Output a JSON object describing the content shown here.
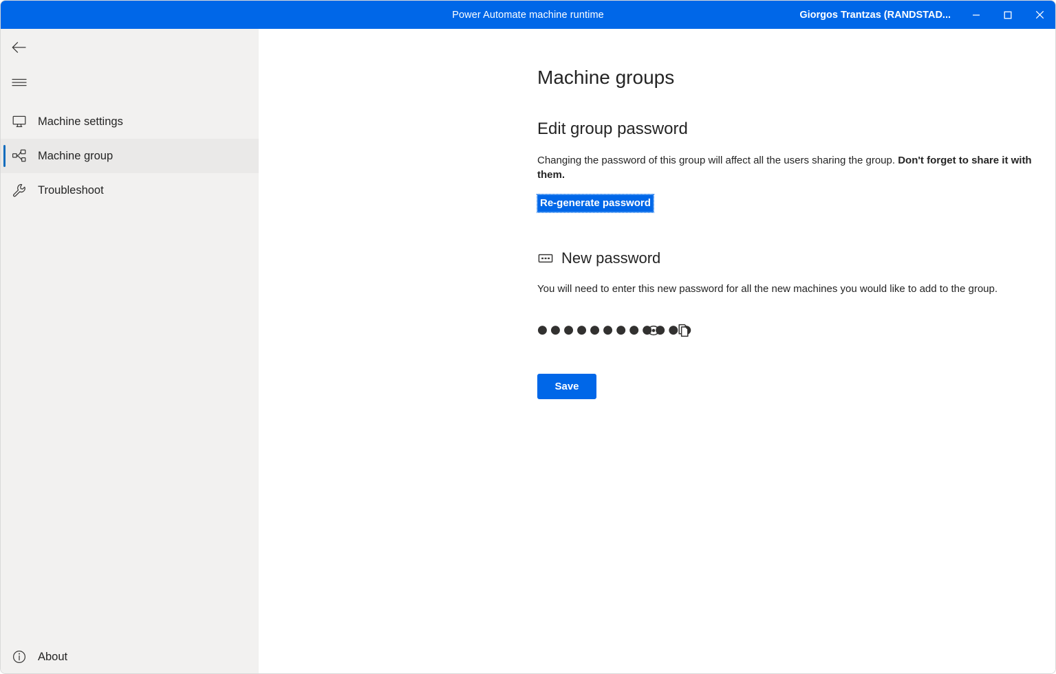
{
  "titlebar": {
    "title": "Power Automate machine runtime",
    "account": "Giorgos Trantzas (RANDSTAD...",
    "minimize_label": "Minimize",
    "maximize_label": "Maximize",
    "close_label": "Close"
  },
  "sidebar": {
    "back_label": "Back",
    "menu_label": "Menu",
    "items": [
      {
        "label": "Machine settings",
        "icon": "monitor-icon",
        "selected": false
      },
      {
        "label": "Machine group",
        "icon": "machine-group-icon",
        "selected": true
      },
      {
        "label": "Troubleshoot",
        "icon": "wrench-icon",
        "selected": false
      }
    ],
    "about": {
      "label": "About",
      "icon": "info-icon"
    }
  },
  "main": {
    "page_title": "Machine groups",
    "section_title": "Edit group password",
    "description_normal": "Changing the password of this group will affect all the users sharing the group. ",
    "description_bold": "Don't forget to share it with them.",
    "regenerate_link": "Re-generate password",
    "new_password": {
      "heading": "New password",
      "heading_icon": "password-field-icon",
      "help_text": "You will need to enter this new password for all the new machines you would like to add to the group.",
      "masked_value": "●●●●●●●●●●●●",
      "show_icon": "eye-icon",
      "copy_icon": "copy-icon"
    },
    "save_label": "Save"
  },
  "colors": {
    "accent": "#0067e8",
    "selected_bar": "#0f6cbd",
    "sidebar_bg": "#f2f1f0",
    "text": "#242424"
  }
}
